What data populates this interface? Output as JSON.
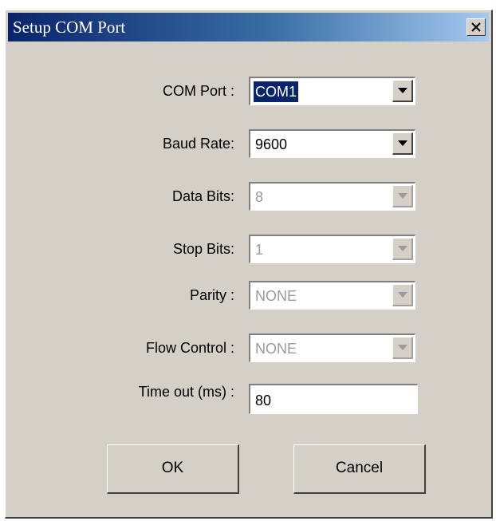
{
  "window": {
    "title": "Setup COM Port"
  },
  "fields": [
    {
      "label": "COM Port :",
      "value": "COM1",
      "enabled": true,
      "selected": true
    },
    {
      "label": "Baud Rate:",
      "value": "9600",
      "enabled": true,
      "selected": false
    },
    {
      "label": "Data Bits:",
      "value": "8",
      "enabled": false,
      "selected": false
    },
    {
      "label": "Stop Bits:",
      "value": "1",
      "enabled": false,
      "selected": false
    },
    {
      "label": "Parity :",
      "value": "NONE",
      "enabled": false,
      "selected": false
    },
    {
      "label": "Flow Control :",
      "value": "NONE",
      "enabled": false,
      "selected": false
    }
  ],
  "timeout": {
    "label": "Time out (ms) :",
    "value": "80"
  },
  "buttons": {
    "ok": "OK",
    "cancel": "Cancel"
  },
  "icons": {
    "close": "close-icon",
    "dropdown": "chevron-down-icon"
  },
  "colors": {
    "titlebar_start": "#0a246a",
    "titlebar_end": "#a6caf0",
    "dialog_face": "#d4d0c8",
    "selection": "#0a246a",
    "disabled_text": "#9a9a9a"
  }
}
